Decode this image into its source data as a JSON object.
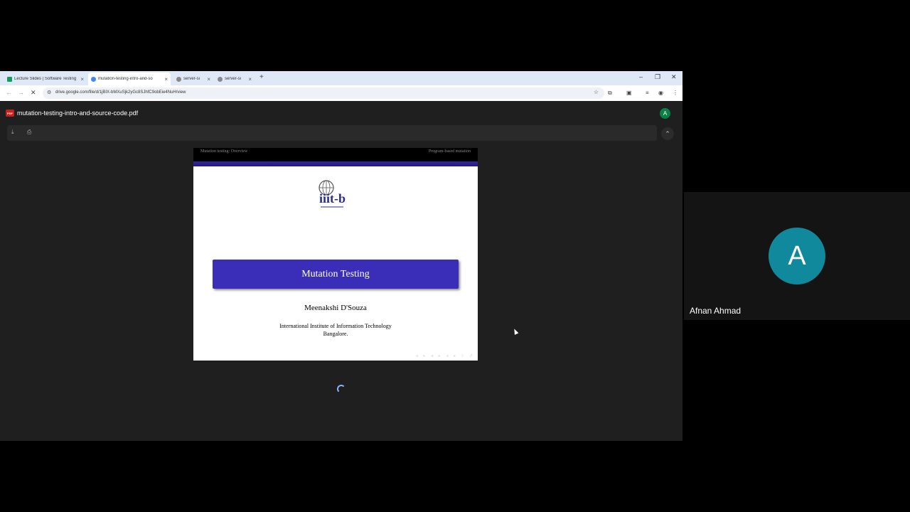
{
  "browser": {
    "tabs": [
      {
        "title": "Lecture Slides | Software Testing",
        "active": false
      },
      {
        "title": "mutation-testing-intro-and-so",
        "active": true
      },
      {
        "title": "server-si",
        "active": false
      },
      {
        "title": "server-si",
        "active": false
      }
    ],
    "new_tab": "+",
    "url": "drive.google.com/file/d/1jBIX-bMXuSjk2yGc8SJhfC9obEie4NuH/view"
  },
  "pdf_viewer": {
    "file_name": "mutation-testing-intro-and-source-code.pdf",
    "badge": "PDF",
    "account_initial": "A"
  },
  "slide": {
    "header_left": "Mutation testing: Overview",
    "header_right": "Program-based mutation",
    "logo_text": "iiit-b",
    "title": "Mutation Testing",
    "author": "Meenakshi D'Souza",
    "institute_line1": "International Institute of Information Technology",
    "institute_line2": "Bangalore."
  },
  "participant": {
    "initial": "A",
    "name": "Afnan Ahmad",
    "avatar_color": "#11899c"
  }
}
